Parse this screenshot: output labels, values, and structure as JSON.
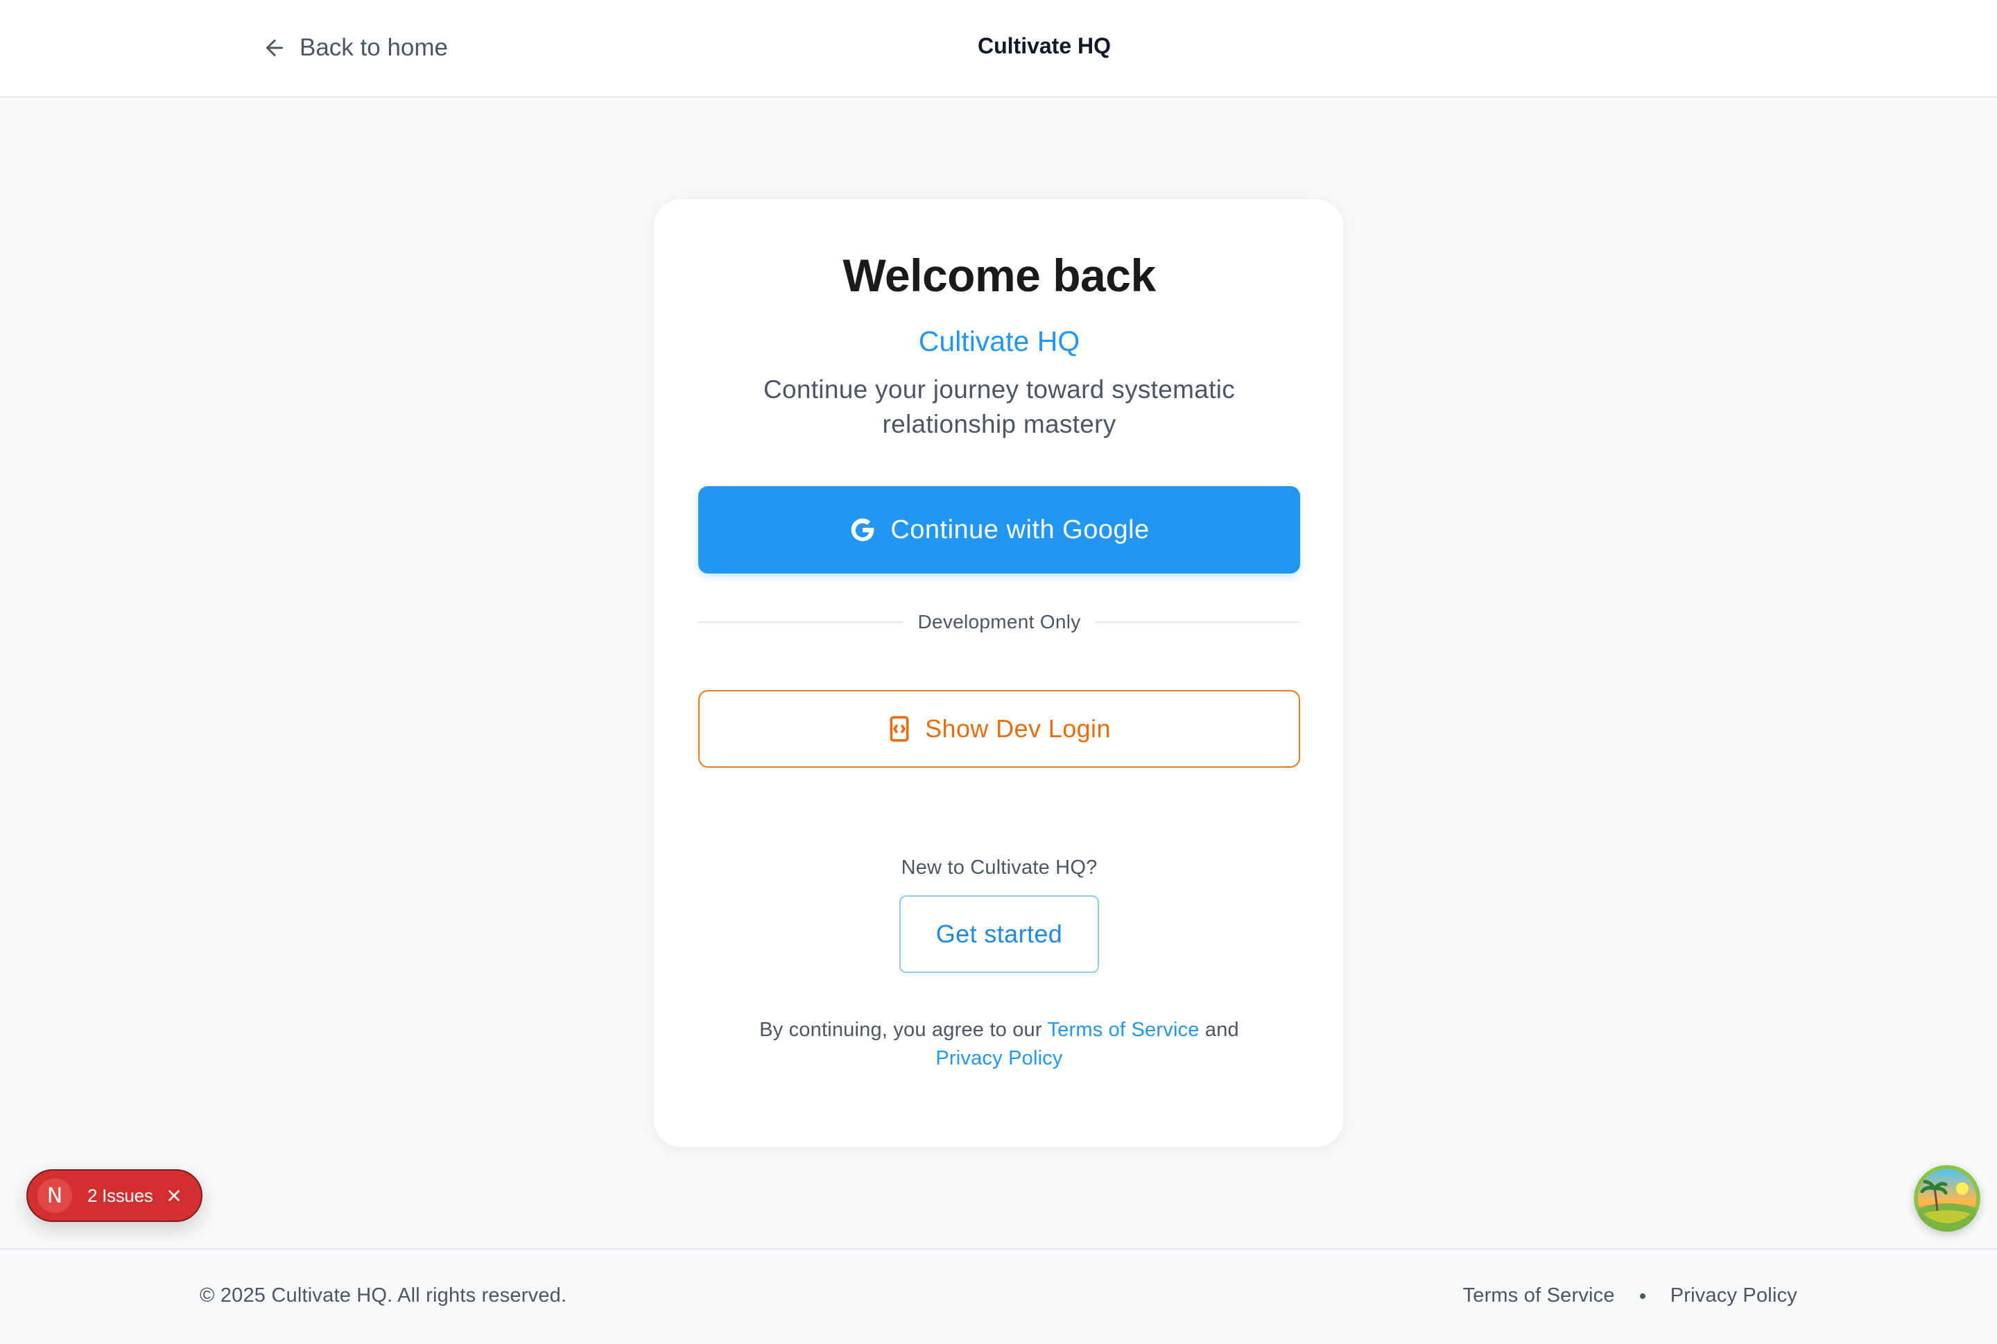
{
  "header": {
    "back_label": "Back to home",
    "brand": "Cultivate HQ"
  },
  "card": {
    "welcome": "Welcome back",
    "brand": "Cultivate HQ",
    "tagline": "Continue your journey toward systematic relationship mastery",
    "google_button": "Continue with Google",
    "divider_label": "Development Only",
    "dev_button": "Show Dev Login",
    "new_to": "New to Cultivate HQ?",
    "get_started": "Get started",
    "legal_prefix": "By continuing, you agree to our",
    "legal_terms": "Terms of Service",
    "legal_and": "and",
    "legal_privacy": "Privacy Policy"
  },
  "issues": {
    "badge": "N",
    "label": "2 Issues"
  },
  "footer": {
    "copyright": "© 2025 Cultivate HQ. All rights reserved.",
    "terms": "Terms of Service",
    "privacy": "Privacy Policy"
  },
  "colors": {
    "accent": "#2196f3",
    "dev_orange": "#ea6c0a",
    "issues_red": "#d32f2f"
  },
  "icons": {
    "back": "arrow-left-icon",
    "google": "google-g-icon",
    "dev": "code-device-icon",
    "close": "close-icon"
  }
}
